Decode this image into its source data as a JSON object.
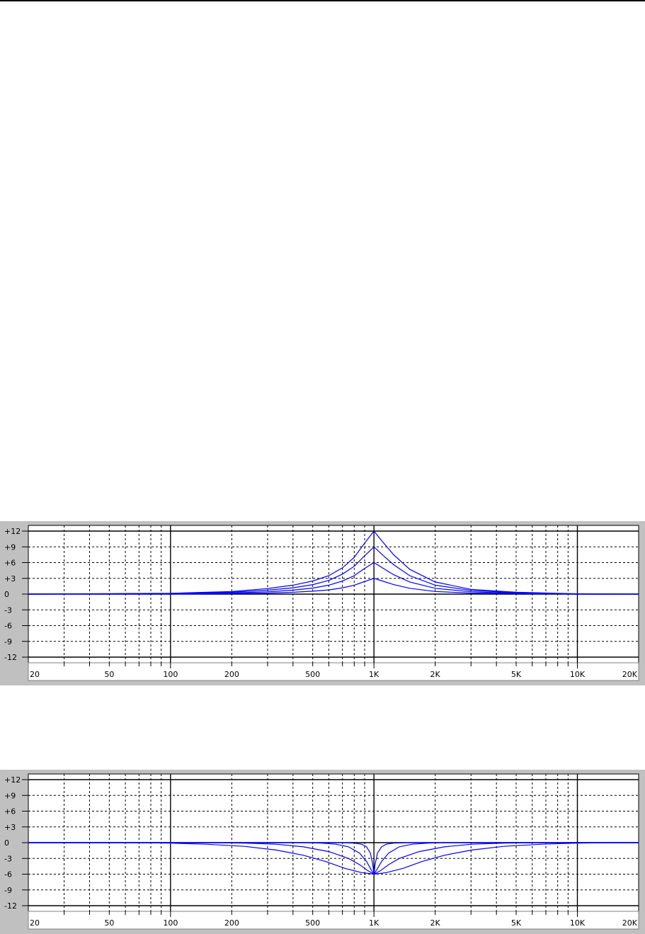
{
  "chart_data": [
    {
      "type": "line",
      "title": "",
      "xlabel": "",
      "ylabel": "",
      "x_scale": "log",
      "xlim": [
        20,
        20000
      ],
      "ylim": [
        -12,
        12
      ],
      "grid": true,
      "y_tick_labels": [
        "+12",
        "+9",
        "+6",
        "+3",
        "0",
        "-3",
        "-6",
        "-9",
        "-12"
      ],
      "y_tick_values": [
        12,
        9,
        6,
        3,
        0,
        -3,
        -6,
        -9,
        -12
      ],
      "x_tick_labels": [
        "20",
        "50",
        "100",
        "200",
        "500",
        "1K",
        "2K",
        "5K",
        "10K",
        "20K"
      ],
      "x_tick_values": [
        20,
        50,
        100,
        200,
        500,
        1000,
        2000,
        5000,
        10000,
        20000
      ],
      "line_color": "#0000ff",
      "series": [
        {
          "x": [
            20,
            100,
            200,
            300,
            400,
            500,
            600,
            700,
            800,
            900,
            1000,
            1100,
            1250,
            1500,
            2000,
            3000,
            5000,
            10000,
            20000
          ],
          "y": [
            0,
            0,
            0.1,
            0.2,
            0.35,
            0.55,
            0.8,
            1.2,
            1.7,
            2.4,
            3.0,
            2.5,
            1.8,
            1.1,
            0.5,
            0.2,
            0.1,
            0,
            0
          ]
        },
        {
          "x": [
            20,
            100,
            200,
            300,
            400,
            500,
            600,
            700,
            800,
            900,
            1000,
            1100,
            1250,
            1500,
            2000,
            3000,
            5000,
            10000,
            20000
          ],
          "y": [
            0,
            0.05,
            0.2,
            0.45,
            0.75,
            1.15,
            1.7,
            2.5,
            3.5,
            4.9,
            6.0,
            5.0,
            3.7,
            2.3,
            1.1,
            0.45,
            0.15,
            0,
            0
          ]
        },
        {
          "x": [
            20,
            100,
            200,
            300,
            400,
            500,
            600,
            700,
            800,
            900,
            1000,
            1100,
            1250,
            1500,
            2000,
            3000,
            5000,
            10000,
            20000
          ],
          "y": [
            0,
            0.1,
            0.35,
            0.75,
            1.2,
            1.8,
            2.6,
            3.8,
            5.3,
            7.3,
            9.0,
            7.5,
            5.6,
            3.5,
            1.7,
            0.7,
            0.25,
            0.05,
            0
          ]
        },
        {
          "x": [
            20,
            100,
            200,
            300,
            400,
            500,
            600,
            700,
            800,
            900,
            1000,
            1100,
            1250,
            1500,
            2000,
            3000,
            5000,
            10000,
            20000
          ],
          "y": [
            0,
            0.15,
            0.5,
            1.05,
            1.7,
            2.5,
            3.5,
            5.0,
            7.0,
            9.7,
            12.0,
            10.0,
            7.5,
            4.7,
            2.3,
            0.9,
            0.35,
            0.05,
            0
          ]
        }
      ]
    },
    {
      "type": "line",
      "title": "",
      "xlabel": "",
      "ylabel": "",
      "x_scale": "log",
      "xlim": [
        20,
        20000
      ],
      "ylim": [
        -12,
        12
      ],
      "grid": true,
      "y_tick_labels": [
        "+12",
        "+9",
        "+6",
        "+3",
        "0",
        "-3",
        "-6",
        "-9",
        "-12"
      ],
      "y_tick_values": [
        12,
        9,
        6,
        3,
        0,
        -3,
        -6,
        -9,
        -12
      ],
      "x_tick_labels": [
        "20",
        "50",
        "100",
        "200",
        "500",
        "1K",
        "2K",
        "5K",
        "10K",
        "20K"
      ],
      "x_tick_values": [
        20,
        50,
        100,
        200,
        500,
        1000,
        2000,
        5000,
        10000,
        20000
      ],
      "line_color": "#0000ff",
      "series": [
        {
          "x": [
            20,
            700,
            800,
            870,
            920,
            960,
            985,
            1000,
            1015,
            1040,
            1090,
            1150,
            1250,
            1500,
            20000
          ],
          "y": [
            0,
            0,
            -0.1,
            -0.3,
            -0.8,
            -2.0,
            -4.0,
            -6.0,
            -4.0,
            -2.0,
            -0.8,
            -0.3,
            -0.1,
            0,
            0
          ]
        },
        {
          "x": [
            20,
            450,
            550,
            650,
            750,
            850,
            920,
            970,
            1000,
            1030,
            1090,
            1180,
            1330,
            1540,
            1850,
            2200,
            20000
          ],
          "y": [
            0,
            0,
            -0.1,
            -0.3,
            -0.8,
            -2.0,
            -3.6,
            -5.2,
            -6.0,
            -5.2,
            -3.6,
            -2.0,
            -0.8,
            -0.3,
            -0.1,
            0,
            0
          ]
        },
        {
          "x": [
            20,
            160,
            230,
            330,
            450,
            600,
            750,
            850,
            930,
            1000,
            1080,
            1180,
            1330,
            1670,
            2220,
            3030,
            4350,
            6250,
            20000
          ],
          "y": [
            0,
            0,
            -0.1,
            -0.3,
            -0.8,
            -1.7,
            -3.0,
            -4.2,
            -5.3,
            -6.0,
            -5.3,
            -4.2,
            -3.0,
            -1.7,
            -0.8,
            -0.3,
            -0.1,
            0,
            0
          ]
        },
        {
          "x": [
            20,
            70,
            100,
            150,
            230,
            330,
            450,
            580,
            720,
            870,
            1000,
            1150,
            1390,
            1720,
            2220,
            3030,
            4350,
            6670,
            10000,
            14300,
            20000
          ],
          "y": [
            0,
            0,
            -0.1,
            -0.3,
            -0.7,
            -1.4,
            -2.4,
            -3.6,
            -4.9,
            -5.7,
            -6.0,
            -5.7,
            -4.9,
            -3.6,
            -2.4,
            -1.4,
            -0.7,
            -0.3,
            -0.1,
            0,
            0
          ]
        }
      ]
    }
  ]
}
